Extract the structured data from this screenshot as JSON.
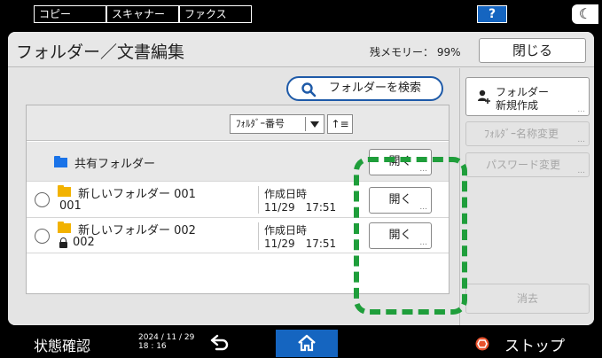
{
  "topbar": {
    "tabs": [
      {
        "label": "コピー"
      },
      {
        "label": "スキャナー"
      },
      {
        "label": "ファクス"
      }
    ],
    "help_label": "?",
    "moon_label": "☾"
  },
  "header": {
    "title": "フォルダー／文書編集",
    "memory_label": "残メモリー： 99%",
    "close_label": "閉じる"
  },
  "search": {
    "label": "フォルダーを検索"
  },
  "sort": {
    "selected": "ﾌｫﾙﾀﾞｰ番号",
    "order_label": "↑≡"
  },
  "list": {
    "shared_folder": {
      "name": "共有フォルダー",
      "open_label": "開く"
    },
    "rows": [
      {
        "name": "新しいフォルダー 001",
        "number": "001",
        "date_label": "作成日時",
        "date_value": "11/29　17:51",
        "open_label": "開く",
        "locked": false
      },
      {
        "name": "新しいフォルダー 002",
        "number": "002",
        "date_label": "作成日時",
        "date_value": "11/29　17:51",
        "open_label": "開く",
        "locked": true
      }
    ],
    "more_dots": "..."
  },
  "side": {
    "new_folder_line1": "フォルダー",
    "new_folder_line2": "新規作成",
    "rename_label": "ﾌｫﾙﾀﾞｰ名称変更",
    "password_label": "パスワード変更",
    "delete_label": "消去",
    "more_dots": "..."
  },
  "bottombar": {
    "status_label": "状態確認",
    "date": "2024 / 11 / 29",
    "time": "18 : 16",
    "stop_label": "ストップ"
  },
  "colors": {
    "highlight": "#1f9e3b",
    "home": "#1565c0",
    "folder_shared": "#1a73e8",
    "folder": "#f2b200",
    "stop": "#e8522e"
  }
}
